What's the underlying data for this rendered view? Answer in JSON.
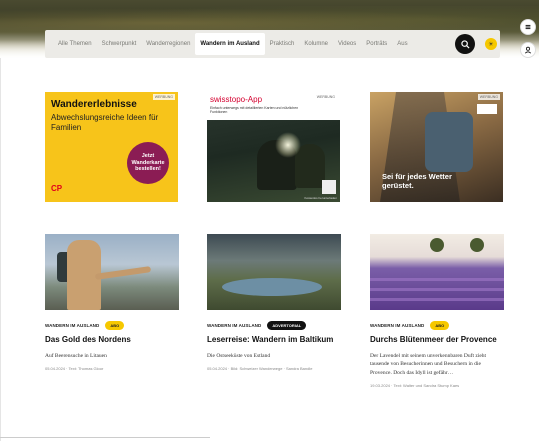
{
  "nav": {
    "items": [
      {
        "label": "Alle Themen"
      },
      {
        "label": "Schwerpunkt"
      },
      {
        "label": "Wanderregionen"
      },
      {
        "label": "Wandern im Ausland",
        "active": true
      },
      {
        "label": "Praktisch"
      },
      {
        "label": "Kolumne"
      },
      {
        "label": "Videos"
      },
      {
        "label": "Porträts"
      },
      {
        "label": "Aus"
      }
    ],
    "search_icon": "search-icon",
    "theme_icon": "sun-icon"
  },
  "side": {
    "menu_icon": "menu-icon",
    "user_icon": "user-icon"
  },
  "ads": [
    {
      "tag": "WERBUNG",
      "title": "Wandererlebnisse",
      "subtitle": "Abwechslungsreiche Ideen für Familien",
      "cta": "Jetzt Wanderkarte bestellen!",
      "logo": "CP",
      "brand_color": "#f7c41a",
      "cta_color": "#8b1c54"
    },
    {
      "tag": "WERBUNG",
      "title": "swisstopo-App",
      "subtitle": "Einfach unterwegs mit detaillierten Karten und nützlichen Funktionen",
      "caption": "Kostenlos herunterladen",
      "brand_color": "#d4002f"
    },
    {
      "tag": "WERBUNG",
      "title": "Sei für jedes Wetter gerüstet."
    }
  ],
  "articles": [
    {
      "category": "WANDERN IM AUSLAND",
      "badge": "ABO",
      "badge_type": "abo",
      "title": "Das Gold des Nordens",
      "lead": "Auf Beerensuche in Litauen",
      "date": "05.04.2024 · Text: Thomas Gloor"
    },
    {
      "category": "WANDERN IM AUSLAND",
      "badge": "ADVERTORIAL",
      "badge_type": "adv",
      "title": "Leserreise: Wandern im Baltikum",
      "lead": "Die Ostseeküste von Estland",
      "date": "05.04.2024 · Bild: Schweizer Wanderwege · Sandra Bandle"
    },
    {
      "category": "WANDERN IM AUSLAND",
      "badge": "ABO",
      "badge_type": "abo",
      "title": "Durchs Blütenmeer der Provence",
      "lead": "Der Lavendel mit seinem unverkennbaren Duft zieht tausende von Besucherinnen und Besuchern in die Provence. Doch das Idyll ist gefähr…",
      "date": "19.03.2024 · Text: Walter und Sandra Stump Kaes"
    }
  ],
  "colors": {
    "accent_yellow": "#f6c800",
    "nav_bg": "#ecebe7"
  }
}
